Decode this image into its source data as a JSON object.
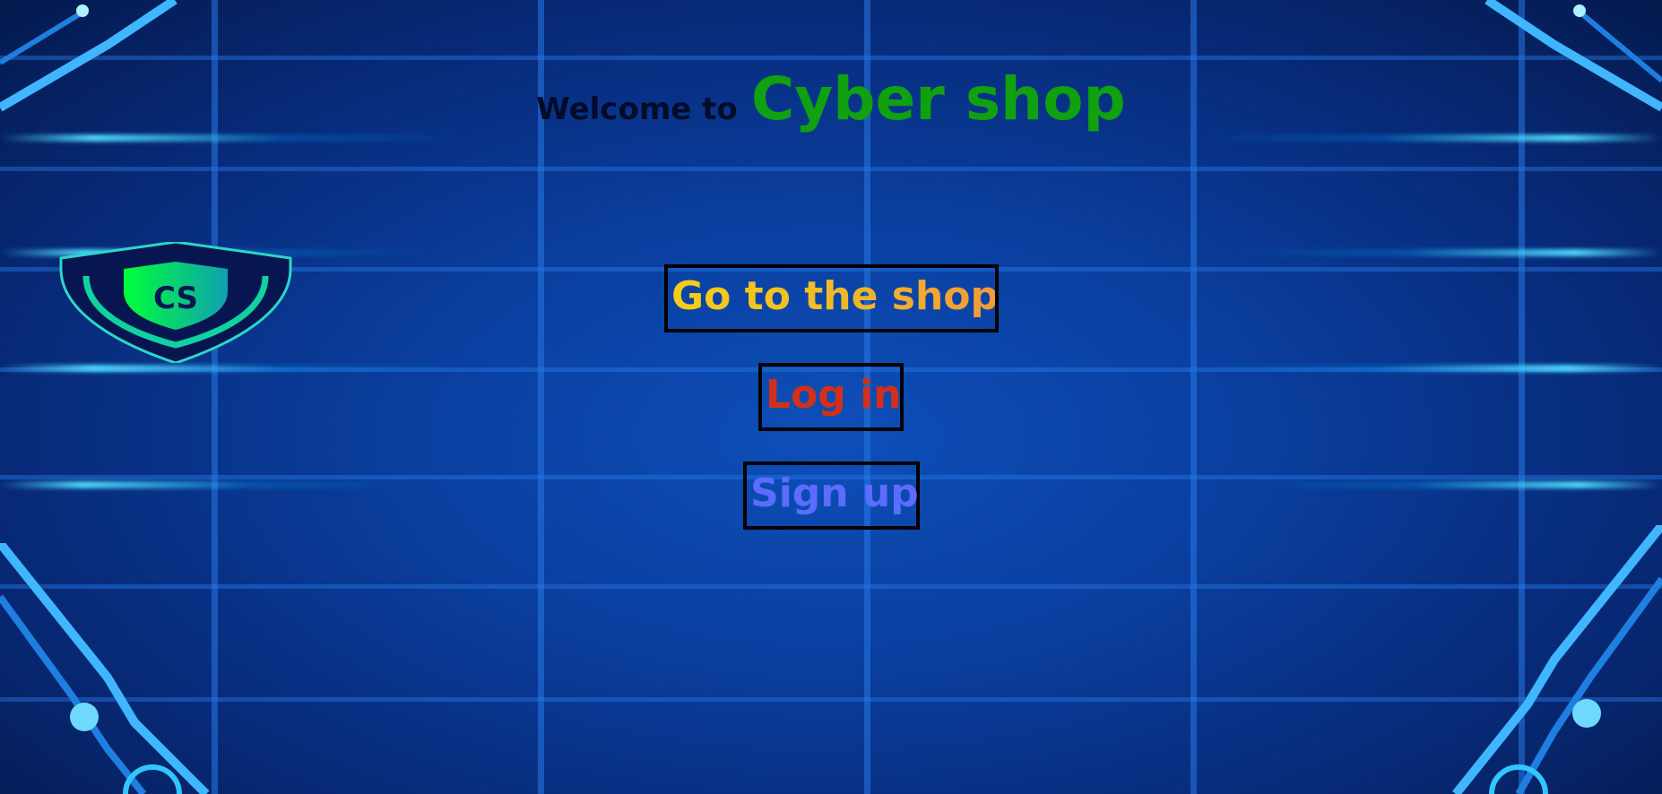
{
  "header": {
    "welcome_text": "Welcome to",
    "brand_name": "Cyber shop"
  },
  "logo": {
    "icon": "cs-shield-logo-icon",
    "letters": "CS"
  },
  "buttons": {
    "shop_label": "Go to the shop",
    "login_label": "Log in",
    "signup_label": "Sign up"
  },
  "colors": {
    "brand_green": "#10a010",
    "shop_gradient_start": "#f7cf16",
    "shop_gradient_end": "#f39a3a",
    "login_red": "#d2301a",
    "signup_blue": "#5b6cff",
    "background_blue": "#0a3fa0"
  }
}
